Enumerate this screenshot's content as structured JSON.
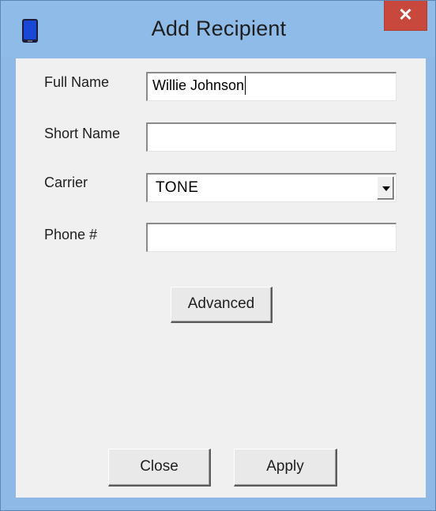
{
  "window": {
    "title": "Add Recipient",
    "close_label": "✕"
  },
  "form": {
    "full_name_label": "Full Name",
    "full_name_value": "Willie Johnson",
    "short_name_label": "Short Name",
    "short_name_value": "",
    "carrier_label": "Carrier",
    "carrier_value": "TONE",
    "phone_label": "Phone #",
    "phone_value": ""
  },
  "buttons": {
    "advanced": "Advanced",
    "close": "Close",
    "apply": "Apply"
  },
  "icons": {
    "app": "phone-icon",
    "close": "close-icon",
    "dropdown": "chevron-down-icon"
  },
  "colors": {
    "titlebar": "#8fbbe8",
    "close_button": "#c8483d",
    "client_bg": "#f0f0f0"
  }
}
